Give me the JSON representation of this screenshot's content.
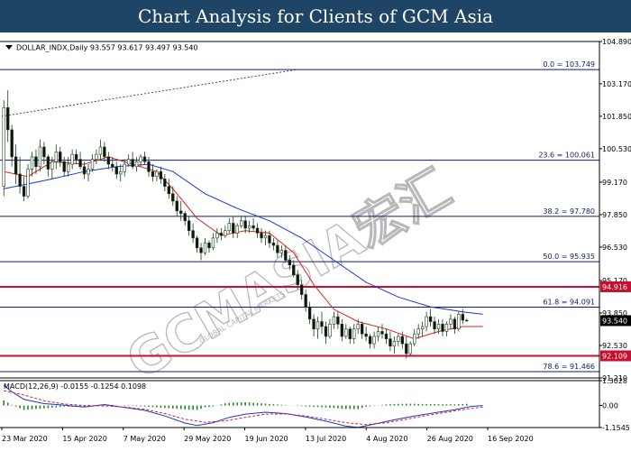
{
  "banner": {
    "title": "Chart Analysis for Clients of GCM Asia"
  },
  "chart_data": {
    "type": "candlestick",
    "symbol_header": "DOLLAR_INDX,Daily  93.557 93.617 93.497 93.540",
    "watermark": "GCMASIA宏汇",
    "watermark_sub": "GLOBAL CAPITAL MARKETS",
    "price_axis": {
      "ylim": [
        91.21,
        104.89
      ],
      "ticks": [
        "104.890",
        "103.170",
        "101.850",
        "100.530",
        "99.170",
        "97.850",
        "96.530",
        "95.170",
        "93.850",
        "92.530",
        "91.210"
      ]
    },
    "x_ticks": [
      "23 Mar 2020",
      "15 Apr 2020",
      "7 May 2020",
      "29 May 2020",
      "19 Jun 2020",
      "13 Jul 2020",
      "4 Aug 2020",
      "26 Aug 2020",
      "16 Sep 2020"
    ],
    "last_price": "93.540",
    "fib_levels": [
      {
        "label": "0.0 = 103.749",
        "value": 103.749
      },
      {
        "label": "23.6 = 100.061",
        "value": 100.061
      },
      {
        "label": "38.2 = 97.780",
        "value": 97.78
      },
      {
        "label": "50.0 = 95.935",
        "value": 95.935
      },
      {
        "label": "61.8 = 94.091",
        "value": 94.091
      },
      {
        "label": "78.6 = 91.466",
        "value": 91.466
      }
    ],
    "key_levels": [
      {
        "label": "94.916",
        "value": 94.916
      },
      {
        "label": "92.109",
        "value": 92.109
      }
    ],
    "trendline": {
      "start": 101.85,
      "end": 103.749
    },
    "candles": [
      [
        99.0,
        102.5,
        98.6,
        102.2
      ],
      [
        102.2,
        102.9,
        100.8,
        101.3
      ],
      [
        101.3,
        101.5,
        99.8,
        100.2
      ],
      [
        100.2,
        100.7,
        99.1,
        99.5
      ],
      [
        99.5,
        100.2,
        98.7,
        99.0
      ],
      [
        99.0,
        99.4,
        98.4,
        98.6
      ],
      [
        98.6,
        99.9,
        98.5,
        99.7
      ],
      [
        99.7,
        100.4,
        99.4,
        100.2
      ],
      [
        100.2,
        100.5,
        99.5,
        99.8
      ],
      [
        99.8,
        100.9,
        99.6,
        100.6
      ],
      [
        100.6,
        100.8,
        99.9,
        100.2
      ],
      [
        100.2,
        100.3,
        99.4,
        99.7
      ],
      [
        99.7,
        100.2,
        99.3,
        100.0
      ],
      [
        100.0,
        100.7,
        99.7,
        100.4
      ],
      [
        100.4,
        100.6,
        99.8,
        100.0
      ],
      [
        100.0,
        100.2,
        99.4,
        99.6
      ],
      [
        99.6,
        100.2,
        99.4,
        99.9
      ],
      [
        99.9,
        100.5,
        99.7,
        100.3
      ],
      [
        100.3,
        100.5,
        99.9,
        100.1
      ],
      [
        100.1,
        100.4,
        99.7,
        99.8
      ],
      [
        99.8,
        100.0,
        99.3,
        99.5
      ],
      [
        99.5,
        99.9,
        99.2,
        99.7
      ],
      [
        99.7,
        100.3,
        99.6,
        100.1
      ],
      [
        100.1,
        100.5,
        99.9,
        100.3
      ],
      [
        100.3,
        100.9,
        100.1,
        100.6
      ],
      [
        100.6,
        100.8,
        100.0,
        100.2
      ],
      [
        100.2,
        100.4,
        99.7,
        99.9
      ],
      [
        99.9,
        100.2,
        99.6,
        99.8
      ],
      [
        99.8,
        100.0,
        99.3,
        99.5
      ],
      [
        99.5,
        99.9,
        99.2,
        99.6
      ],
      [
        99.6,
        100.1,
        99.4,
        99.9
      ],
      [
        99.9,
        100.3,
        99.8,
        100.1
      ],
      [
        100.1,
        100.4,
        99.7,
        99.8
      ],
      [
        99.8,
        100.2,
        99.6,
        100.0
      ],
      [
        100.0,
        100.3,
        99.8,
        100.2
      ],
      [
        100.2,
        100.4,
        99.9,
        100.0
      ],
      [
        100.0,
        100.2,
        99.4,
        99.6
      ],
      [
        99.6,
        99.9,
        99.2,
        99.4
      ],
      [
        99.4,
        99.7,
        99.2,
        99.6
      ],
      [
        99.6,
        99.8,
        99.1,
        99.3
      ],
      [
        99.3,
        99.5,
        98.8,
        99.0
      ],
      [
        99.0,
        99.3,
        98.5,
        98.7
      ],
      [
        98.7,
        99.0,
        98.2,
        98.4
      ],
      [
        98.4,
        98.6,
        97.8,
        98.0
      ],
      [
        98.0,
        98.4,
        97.6,
        97.9
      ],
      [
        97.9,
        98.0,
        97.4,
        97.6
      ],
      [
        97.6,
        97.8,
        97.0,
        97.2
      ],
      [
        97.2,
        97.5,
        96.7,
        96.9
      ],
      [
        96.9,
        97.0,
        96.3,
        96.5
      ],
      [
        96.5,
        96.7,
        96.0,
        96.3
      ],
      [
        96.3,
        96.9,
        96.2,
        96.7
      ],
      [
        96.7,
        96.8,
        96.3,
        96.5
      ],
      [
        96.5,
        97.1,
        96.4,
        96.9
      ],
      [
        96.9,
        97.3,
        96.7,
        97.1
      ],
      [
        97.1,
        97.3,
        96.8,
        97.0
      ],
      [
        97.0,
        97.4,
        96.9,
        97.2
      ],
      [
        97.2,
        97.7,
        97.1,
        97.5
      ],
      [
        97.5,
        97.8,
        96.9,
        97.1
      ],
      [
        97.1,
        97.5,
        96.9,
        97.4
      ],
      [
        97.4,
        97.8,
        97.3,
        97.6
      ],
      [
        97.6,
        97.8,
        97.1,
        97.3
      ],
      [
        97.3,
        97.6,
        97.1,
        97.4
      ],
      [
        97.4,
        97.7,
        97.2,
        97.3
      ],
      [
        97.3,
        97.5,
        96.9,
        97.1
      ],
      [
        97.1,
        97.3,
        96.7,
        96.9
      ],
      [
        96.9,
        97.2,
        96.6,
        97.0
      ],
      [
        97.0,
        97.2,
        96.5,
        96.7
      ],
      [
        96.7,
        96.9,
        96.4,
        96.6
      ],
      [
        96.6,
        96.8,
        96.1,
        96.3
      ],
      [
        96.3,
        96.6,
        96.1,
        96.4
      ],
      [
        96.4,
        96.6,
        95.9,
        96.0
      ],
      [
        96.0,
        96.2,
        95.6,
        95.8
      ],
      [
        95.8,
        96.0,
        95.3,
        95.4
      ],
      [
        95.4,
        95.6,
        94.8,
        95.0
      ],
      [
        95.0,
        95.2,
        94.4,
        94.6
      ],
      [
        94.6,
        94.8,
        93.9,
        94.1
      ],
      [
        94.1,
        94.3,
        93.4,
        93.6
      ],
      [
        93.6,
        93.8,
        92.9,
        93.2
      ],
      [
        93.2,
        93.7,
        92.8,
        93.5
      ],
      [
        93.5,
        93.9,
        93.0,
        93.3
      ],
      [
        93.3,
        93.5,
        92.6,
        92.9
      ],
      [
        92.9,
        93.6,
        92.8,
        93.4
      ],
      [
        93.4,
        93.9,
        93.2,
        93.7
      ],
      [
        93.7,
        93.9,
        93.2,
        93.4
      ],
      [
        93.4,
        93.6,
        92.7,
        92.9
      ],
      [
        92.9,
        93.4,
        92.8,
        93.2
      ],
      [
        93.2,
        93.3,
        92.6,
        92.8
      ],
      [
        92.8,
        93.4,
        92.6,
        93.2
      ],
      [
        93.2,
        93.6,
        93.0,
        93.4
      ],
      [
        93.4,
        93.5,
        92.8,
        93.0
      ],
      [
        93.0,
        93.3,
        92.7,
        92.9
      ],
      [
        92.9,
        93.0,
        92.4,
        92.6
      ],
      [
        92.6,
        93.1,
        92.4,
        92.9
      ],
      [
        92.9,
        93.3,
        92.7,
        93.1
      ],
      [
        93.1,
        93.4,
        92.8,
        93.0
      ],
      [
        93.0,
        93.2,
        92.6,
        92.8
      ],
      [
        92.8,
        93.1,
        92.3,
        92.5
      ],
      [
        92.5,
        92.9,
        92.2,
        92.7
      ],
      [
        92.7,
        93.0,
        92.5,
        92.9
      ],
      [
        92.9,
        93.1,
        92.4,
        92.6
      ],
      [
        92.6,
        92.9,
        92.0,
        92.2
      ],
      [
        92.2,
        92.7,
        92.1,
        92.6
      ],
      [
        92.6,
        93.2,
        92.5,
        93.0
      ],
      [
        93.0,
        93.4,
        92.8,
        93.2
      ],
      [
        93.2,
        93.5,
        92.9,
        93.3
      ],
      [
        93.3,
        93.9,
        93.1,
        93.7
      ],
      [
        93.7,
        94.0,
        93.3,
        93.5
      ],
      [
        93.5,
        93.7,
        93.0,
        93.2
      ],
      [
        93.2,
        93.6,
        93.0,
        93.4
      ],
      [
        93.4,
        93.6,
        92.9,
        93.1
      ],
      [
        93.1,
        93.5,
        92.9,
        93.4
      ],
      [
        93.4,
        93.8,
        93.2,
        93.6
      ],
      [
        93.6,
        93.7,
        93.0,
        93.2
      ],
      [
        93.2,
        93.9,
        93.1,
        93.8
      ],
      [
        93.8,
        94.0,
        93.4,
        93.557
      ],
      [
        93.557,
        93.617,
        93.497,
        93.54
      ]
    ],
    "ma_fast": [
      [
        0,
        99.6
      ],
      [
        6,
        99.4
      ],
      [
        12,
        100.0
      ],
      [
        20,
        99.9
      ],
      [
        26,
        100.2
      ],
      [
        32,
        99.9
      ],
      [
        38,
        99.6
      ],
      [
        42,
        98.9
      ],
      [
        48,
        97.7
      ],
      [
        54,
        97.0
      ],
      [
        60,
        97.2
      ],
      [
        66,
        97.1
      ],
      [
        72,
        96.3
      ],
      [
        77,
        95.0
      ],
      [
        82,
        94.0
      ],
      [
        88,
        93.5
      ],
      [
        95,
        93.2
      ],
      [
        102,
        92.8
      ],
      [
        108,
        93.1
      ],
      [
        114,
        93.3
      ],
      [
        119,
        93.3
      ]
    ],
    "ma_slow": [
      [
        0,
        98.9
      ],
      [
        6,
        99.1
      ],
      [
        12,
        99.3
      ],
      [
        20,
        99.6
      ],
      [
        28,
        99.8
      ],
      [
        36,
        99.9
      ],
      [
        42,
        99.6
      ],
      [
        50,
        98.7
      ],
      [
        58,
        98.1
      ],
      [
        66,
        97.6
      ],
      [
        74,
        96.9
      ],
      [
        82,
        96.0
      ],
      [
        90,
        95.1
      ],
      [
        98,
        94.5
      ],
      [
        106,
        94.1
      ],
      [
        114,
        93.9
      ],
      [
        119,
        93.8
      ]
    ],
    "macd": {
      "label": "MACD(12,26,9) -0.0155 -0.1254 0.1098",
      "ylim": [
        -1.1545,
        1.3028
      ],
      "ticks": [
        "1.3028",
        "0.00",
        "-1.1545"
      ],
      "main": [
        [
          0,
          1.05
        ],
        [
          2,
          0.72
        ],
        [
          5,
          0.32
        ],
        [
          10,
          0.1
        ],
        [
          15,
          0.02
        ],
        [
          20,
          -0.08
        ],
        [
          25,
          0.05
        ],
        [
          30,
          -0.1
        ],
        [
          35,
          -0.25
        ],
        [
          40,
          -0.55
        ],
        [
          45,
          -0.92
        ],
        [
          48,
          -1.05
        ],
        [
          52,
          -0.9
        ],
        [
          56,
          -0.62
        ],
        [
          60,
          -0.45
        ],
        [
          65,
          -0.35
        ],
        [
          70,
          -0.42
        ],
        [
          75,
          -0.6
        ],
        [
          80,
          -0.82
        ],
        [
          85,
          -1.08
        ],
        [
          88,
          -1.15
        ],
        [
          92,
          -0.98
        ],
        [
          97,
          -0.75
        ],
        [
          102,
          -0.55
        ],
        [
          107,
          -0.38
        ],
        [
          112,
          -0.22
        ],
        [
          116,
          -0.05
        ],
        [
          119,
          0.0
        ]
      ],
      "signal": [
        [
          0,
          0.78
        ],
        [
          5,
          0.55
        ],
        [
          10,
          0.25
        ],
        [
          15,
          0.08
        ],
        [
          20,
          0.0
        ],
        [
          25,
          -0.02
        ],
        [
          30,
          -0.08
        ],
        [
          35,
          -0.2
        ],
        [
          40,
          -0.42
        ],
        [
          45,
          -0.72
        ],
        [
          50,
          -0.88
        ],
        [
          55,
          -0.8
        ],
        [
          60,
          -0.62
        ],
        [
          65,
          -0.45
        ],
        [
          70,
          -0.44
        ],
        [
          75,
          -0.55
        ],
        [
          80,
          -0.72
        ],
        [
          85,
          -0.9
        ],
        [
          90,
          -1.0
        ],
        [
          95,
          -0.9
        ],
        [
          100,
          -0.72
        ],
        [
          105,
          -0.52
        ],
        [
          110,
          -0.35
        ],
        [
          115,
          -0.18
        ],
        [
          119,
          -0.08
        ]
      ]
    }
  }
}
